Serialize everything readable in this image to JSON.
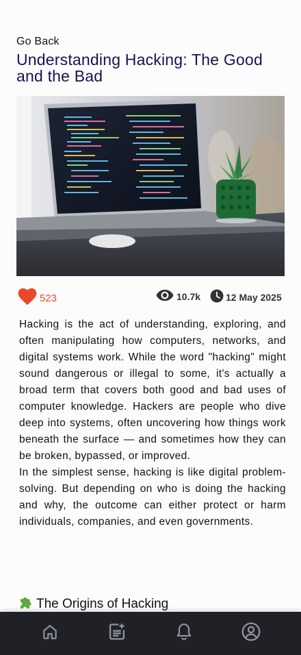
{
  "nav": {
    "back_label": "Go Back"
  },
  "article": {
    "title": "Understanding Hacking: The Good and the Bad",
    "hero_image": "laptop-with-code-and-succulent-photo",
    "likes": "523",
    "views": "10.7k",
    "date": "12 May 2025",
    "paragraphs": [
      "Hacking is the act of understanding, exploring, and often manipulating how computers, networks, and digital systems work. While the word \"hacking\" might sound dangerous or illegal to some, it's actually a broad term that covers both good and bad uses of computer knowledge. Hackers are people who dive deep into systems, often uncovering how things work beneath the surface — and sometimes how they can be broken, bypassed, or improved.",
      "In the simplest sense, hacking is like digital problem-solving. But depending on who is doing the hacking and why, the outcome can either protect or harm individuals, companies, and even governments."
    ],
    "section_icon": "puzzle-piece-emoji",
    "section_heading": "The Origins of Hacking"
  },
  "bottom_nav": {
    "items": [
      {
        "icon": "home-icon"
      },
      {
        "icon": "news-add-icon"
      },
      {
        "icon": "bell-icon"
      },
      {
        "icon": "profile-icon"
      }
    ]
  },
  "colors": {
    "title": "#14144f",
    "like": "#e8492d",
    "nav_bg": "#1f2127",
    "nav_icon": "#8f939b"
  }
}
